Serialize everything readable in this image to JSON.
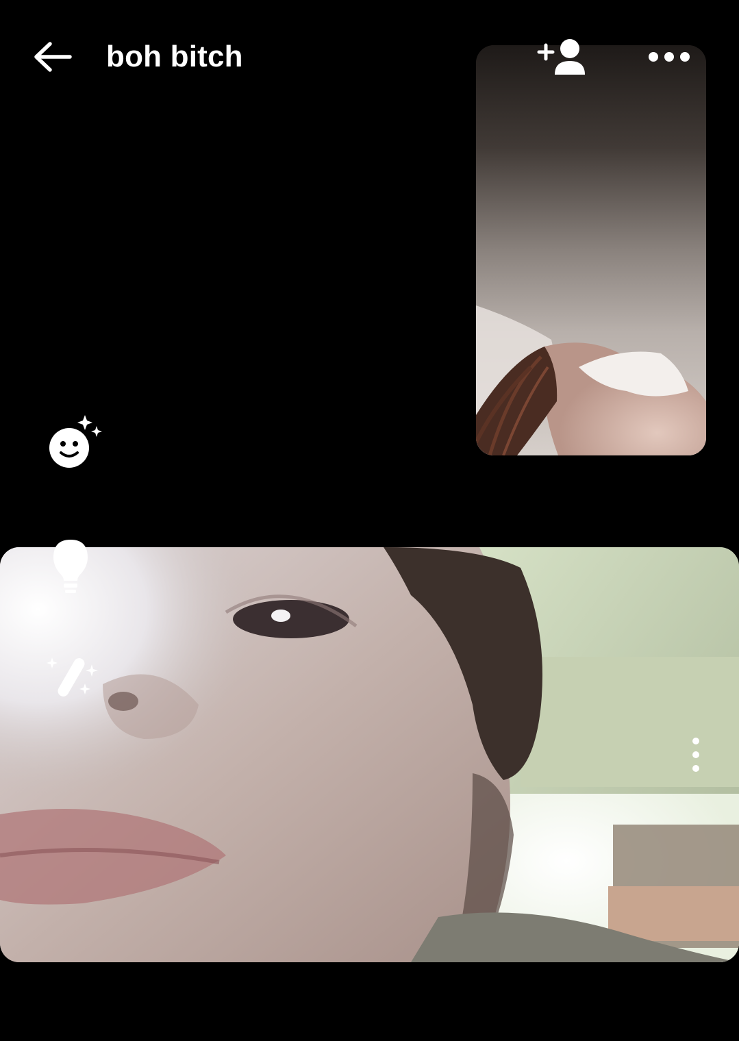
{
  "header": {
    "contact_name": "boh bitch"
  },
  "icons": {
    "back": "back-arrow-icon",
    "add_person": "add-person-icon",
    "more": "more-horizontal-icon",
    "effects": "smiley-sparkle-icon",
    "lighting": "lightbulb-icon",
    "filters": "magic-wand-icon",
    "tile_more": "more-vertical-icon"
  },
  "colors": {
    "background": "#000000",
    "icon": "#ffffff"
  }
}
